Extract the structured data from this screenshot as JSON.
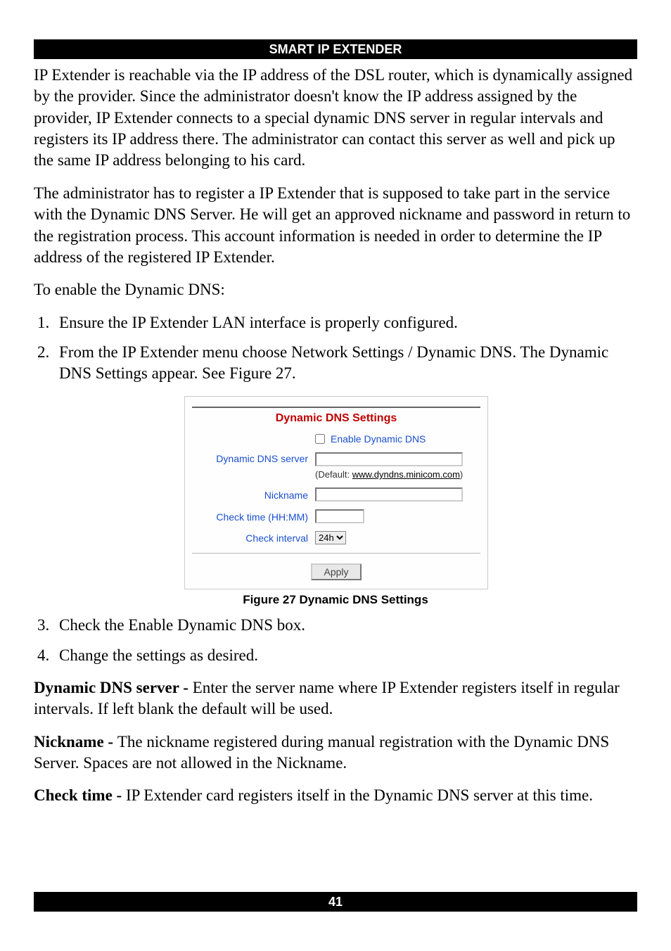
{
  "header": {
    "title": "SMART IP EXTENDER"
  },
  "footer": {
    "page_number": "41"
  },
  "body": {
    "para1": "IP Extender is reachable via the IP address of the DSL router, which is dynamically assigned by the provider. Since the administrator doesn't know the IP address assigned by the provider, IP Extender connects to a special dynamic DNS server in regular intervals and registers its IP address there. The administrator can contact this server as well and pick up the same IP address belonging to his card.",
    "para2": "The administrator has to register a IP Extender that is supposed to take part in the service with the Dynamic DNS Server. He will get an approved nickname and password in return to the registration process. This account information is needed in order to determine the IP address of the registered IP Extender.",
    "para3": "To enable the Dynamic DNS:",
    "step1": "Ensure the IP Extender LAN interface is properly configured.",
    "step2": "From the IP Extender menu choose Network Settings / Dynamic DNS. The Dynamic DNS Settings appear. See Figure 27.",
    "step3": "Check the Enable Dynamic DNS box.",
    "step4": "Change the settings as desired.",
    "term_dns_label": "Dynamic DNS server - ",
    "term_dns_text": "Enter the server name where IP Extender registers itself in regular intervals. If left blank the default will be used.",
    "term_nick_label": "Nickname - ",
    "term_nick_text": "The nickname registered during manual registration with the Dynamic DNS Server. Spaces are not allowed in the Nickname.",
    "term_time_label": "Check time - ",
    "term_time_text": "IP Extender card registers itself in the Dynamic DNS server at this time."
  },
  "figure": {
    "caption": "Figure 27 Dynamic DNS Settings",
    "dialog": {
      "title": "Dynamic DNS Settings",
      "enable_label": "Enable Dynamic DNS",
      "server_label": "Dynamic DNS server",
      "server_value": "",
      "server_default_prefix": "(Default: ",
      "server_default_link": "www.dyndns.minicom.com",
      "server_default_suffix": ")",
      "nickname_label": "Nickname",
      "nickname_value": "",
      "checktime_label": "Check time (HH:MM)",
      "checktime_value": "",
      "checkinterval_label": "Check interval",
      "checkinterval_value": "24h",
      "apply_label": "Apply"
    }
  }
}
